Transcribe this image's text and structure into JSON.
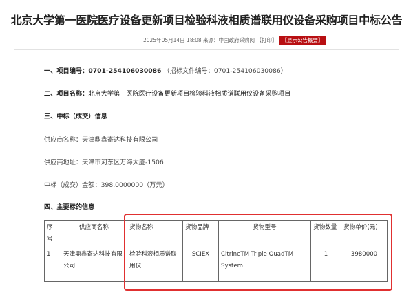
{
  "page": {
    "title": "北京大学第一医院医疗设备更新项目检验科液相质谱联用仪设备采购项目中标公告",
    "meta": "2025年05月14日 18:08  来源：中国政府采购网 【打印】",
    "meta_badge": "【显示公告概要】"
  },
  "sections": {
    "s1_label": "一、项目编号：",
    "s1_value": "0701-254106030086",
    "s1_note": "（招标文件编号：0701-254106030086）",
    "s2_label": "二、项目名称：",
    "s2_value": "北京大学第一医院医疗设备更新项目检验科液相质谱联用仪设备采购项目",
    "s3": "三、中标（成交）信息",
    "s4": "四、主要标的信息"
  },
  "fields": {
    "supplier_name": "供应商名称：天津鼎鑫寄达科技有限公司",
    "supplier_address": "供应商地址：天津市河东区万海大厦-1506",
    "amount": "中标（成交）金额：398.0000000（万元）"
  },
  "table": {
    "headers": [
      "序号",
      "供应商名称",
      "货物名称",
      "货物品牌",
      "货物型号",
      "货物数量",
      "货物单价(元)"
    ],
    "rows": [
      [
        "1",
        "天津鼎鑫寄达科技有限公司",
        "检验科液相质谱联用仪",
        "SCIEX",
        "CitrineTM Triple QuadTM System",
        "1",
        "3980000"
      ]
    ]
  }
}
